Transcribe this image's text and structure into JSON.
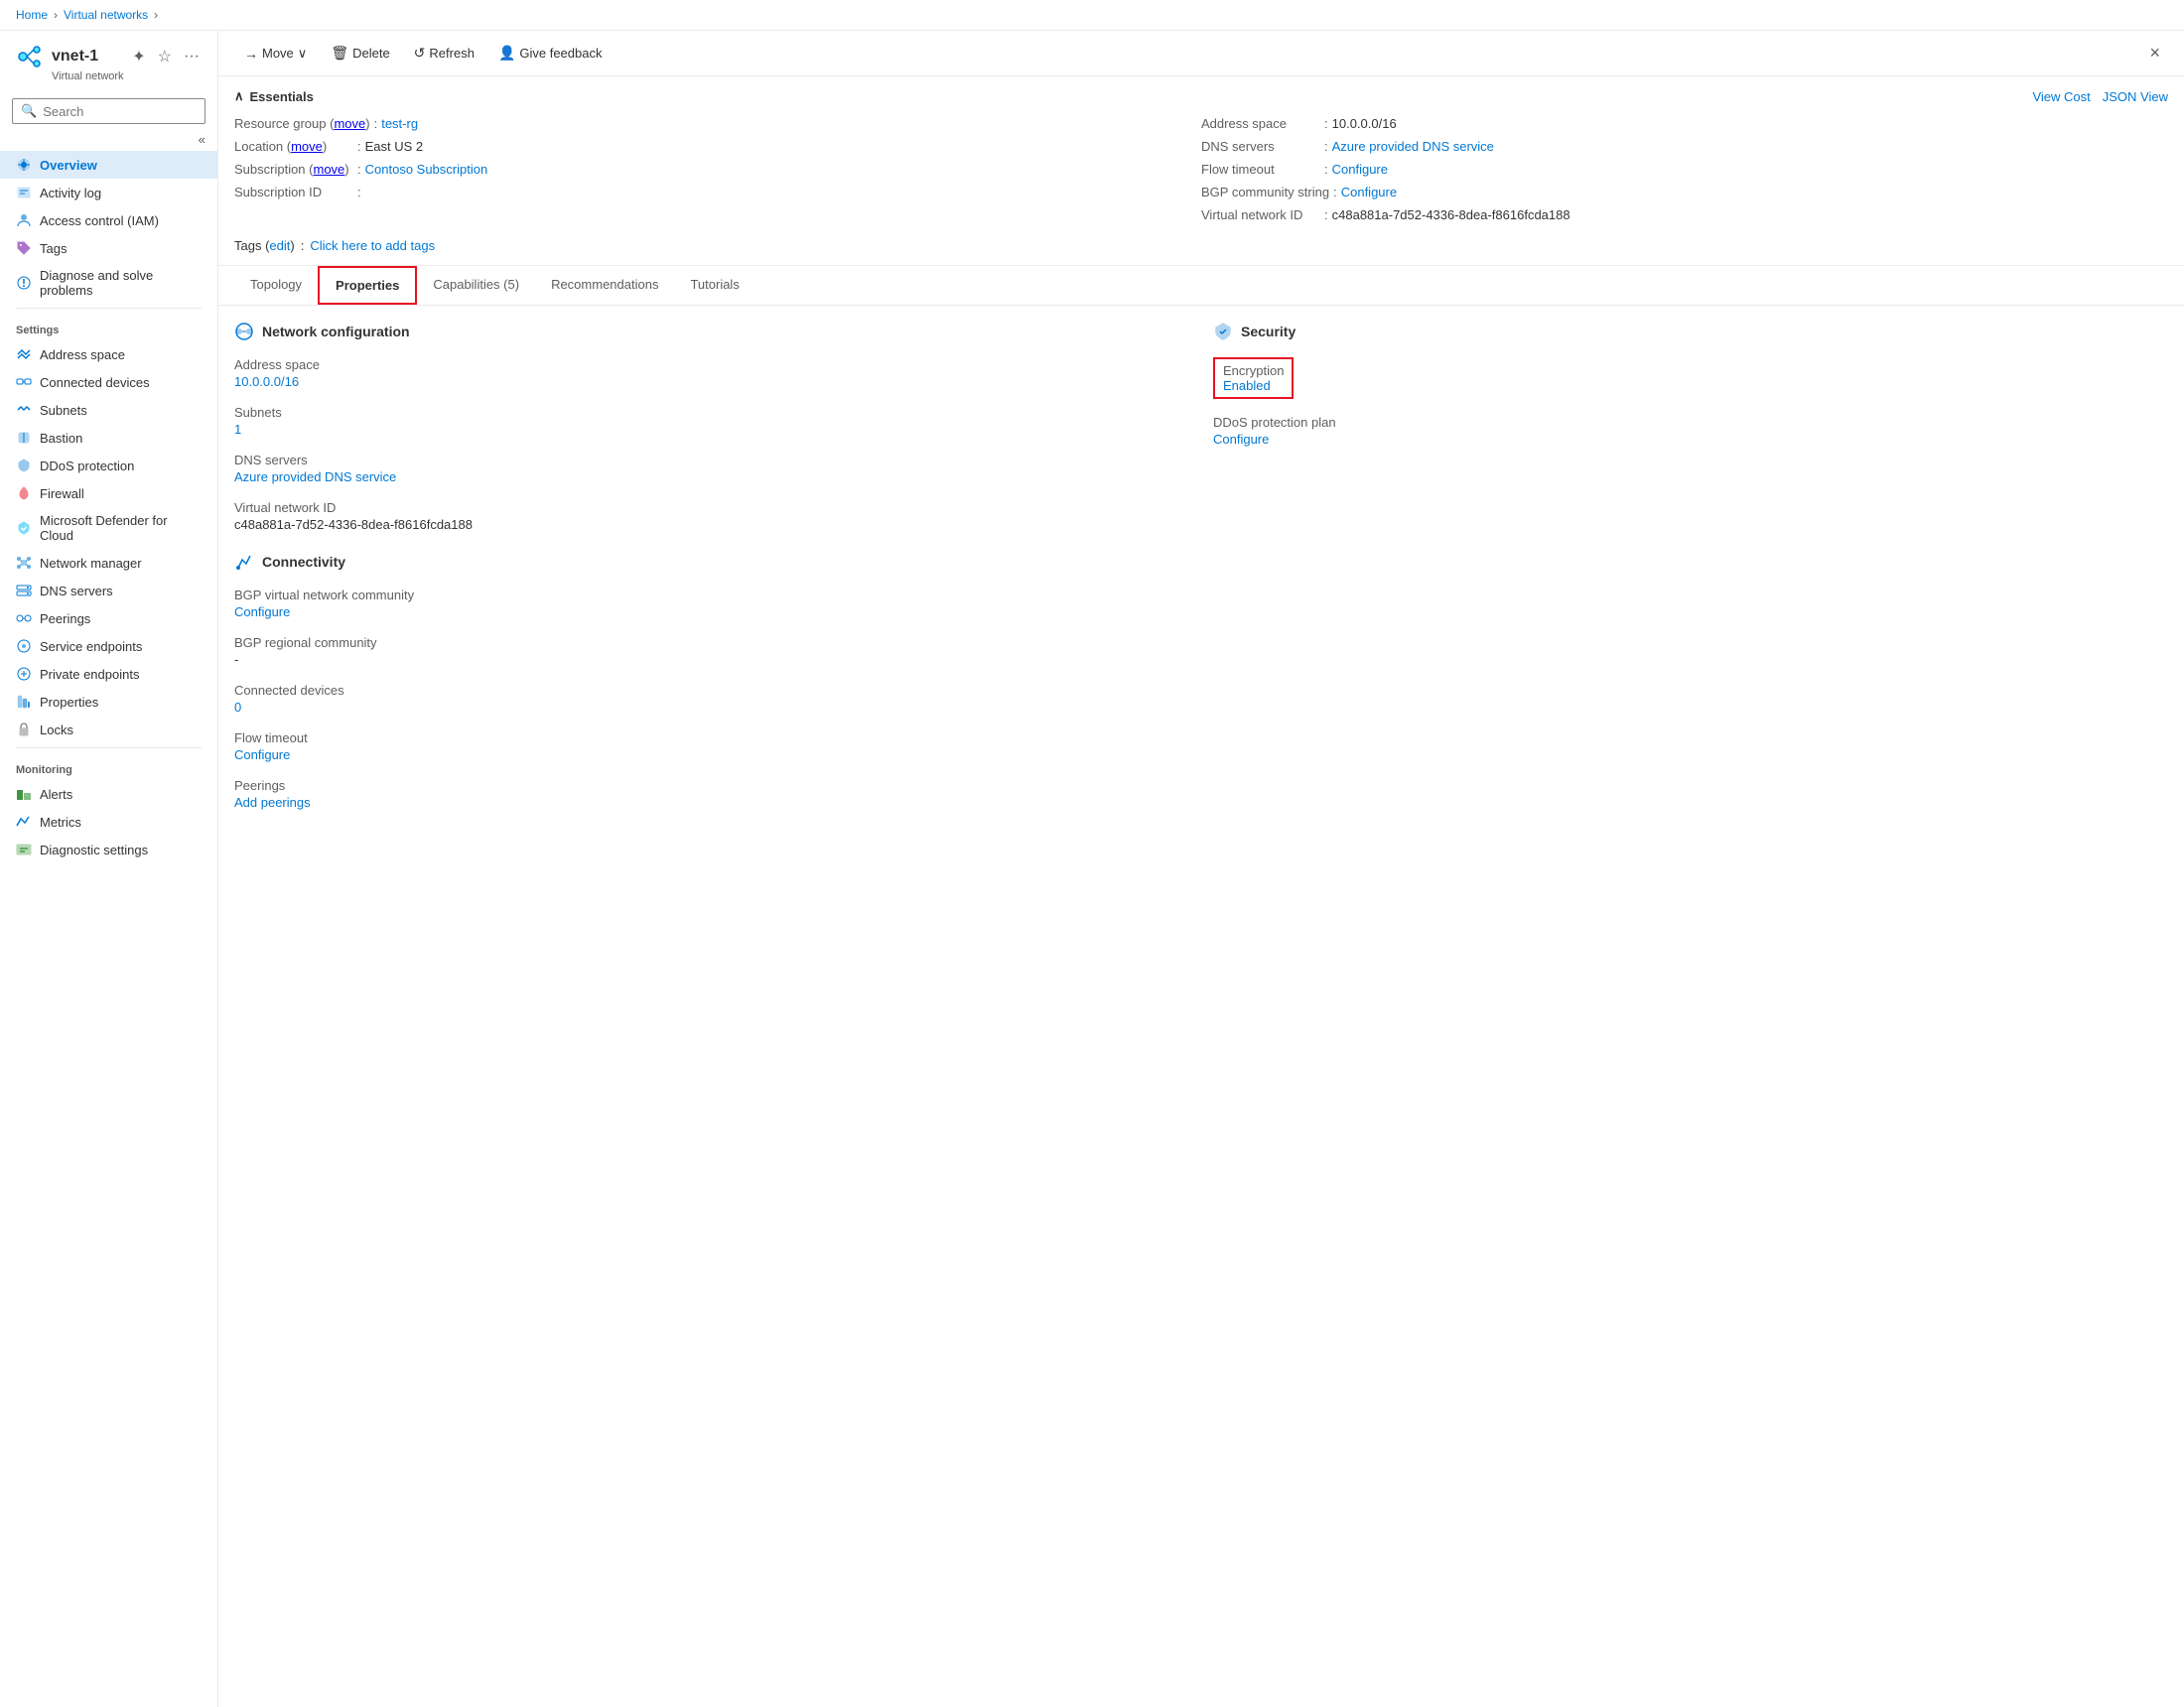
{
  "breadcrumb": {
    "home": "Home",
    "virtual_networks": "Virtual networks"
  },
  "sidebar": {
    "app_name": "vnet-1",
    "app_subtitle": "Virtual network",
    "search_placeholder": "Search",
    "collapse_icon": "«",
    "nav_items": [
      {
        "id": "overview",
        "label": "Overview",
        "icon": "vnet",
        "active": true
      },
      {
        "id": "activity-log",
        "label": "Activity log",
        "icon": "activity"
      },
      {
        "id": "access-control",
        "label": "Access control (IAM)",
        "icon": "iam"
      },
      {
        "id": "tags",
        "label": "Tags",
        "icon": "tags"
      },
      {
        "id": "diagnose",
        "label": "Diagnose and solve problems",
        "icon": "diagnose"
      }
    ],
    "settings_label": "Settings",
    "settings_items": [
      {
        "id": "address-space",
        "label": "Address space",
        "icon": "address"
      },
      {
        "id": "connected-devices",
        "label": "Connected devices",
        "icon": "connected"
      },
      {
        "id": "subnets",
        "label": "Subnets",
        "icon": "subnets"
      },
      {
        "id": "bastion",
        "label": "Bastion",
        "icon": "bastion"
      },
      {
        "id": "ddos-protection",
        "label": "DDoS protection",
        "icon": "ddos"
      },
      {
        "id": "firewall",
        "label": "Firewall",
        "icon": "firewall"
      },
      {
        "id": "microsoft-defender",
        "label": "Microsoft Defender for Cloud",
        "icon": "defender"
      },
      {
        "id": "network-manager",
        "label": "Network manager",
        "icon": "network-manager"
      },
      {
        "id": "dns-servers",
        "label": "DNS servers",
        "icon": "dns"
      },
      {
        "id": "peerings",
        "label": "Peerings",
        "icon": "peerings"
      },
      {
        "id": "service-endpoints",
        "label": "Service endpoints",
        "icon": "service-endpoints"
      },
      {
        "id": "private-endpoints",
        "label": "Private endpoints",
        "icon": "private-endpoints"
      },
      {
        "id": "properties",
        "label": "Properties",
        "icon": "properties"
      },
      {
        "id": "locks",
        "label": "Locks",
        "icon": "locks"
      }
    ],
    "monitoring_label": "Monitoring",
    "monitoring_items": [
      {
        "id": "alerts",
        "label": "Alerts",
        "icon": "alerts"
      },
      {
        "id": "metrics",
        "label": "Metrics",
        "icon": "metrics"
      },
      {
        "id": "diagnostic-settings",
        "label": "Diagnostic settings",
        "icon": "diagnostic"
      }
    ]
  },
  "toolbar": {
    "move_label": "Move",
    "delete_label": "Delete",
    "refresh_label": "Refresh",
    "feedback_label": "Give feedback",
    "close_icon": "×"
  },
  "essentials": {
    "title": "Essentials",
    "collapse_icon": "∧",
    "view_cost_label": "View Cost",
    "json_view_label": "JSON View",
    "resource_group_label": "Resource group (move)",
    "resource_group_value": "test-rg",
    "location_label": "Location (move)",
    "location_value": "East US 2",
    "subscription_label": "Subscription (move)",
    "subscription_value": "Contoso Subscription",
    "subscription_id_label": "Subscription ID",
    "subscription_id_value": "",
    "address_space_label": "Address space",
    "address_space_value": "10.0.0.0/16",
    "dns_servers_label": "DNS servers",
    "dns_servers_value": "Azure provided DNS service",
    "flow_timeout_label": "Flow timeout",
    "flow_timeout_value": "Configure",
    "bgp_community_label": "BGP community string",
    "bgp_community_value": "Configure",
    "virtual_network_id_label": "Virtual network ID",
    "virtual_network_id_value": "c48a881a-7d52-4336-8dea-f8616fcda188",
    "tags_label": "Tags (edit)",
    "tags_placeholder": "Click here to add tags"
  },
  "tabs": [
    {
      "id": "topology",
      "label": "Topology",
      "active": false,
      "highlighted": false
    },
    {
      "id": "properties",
      "label": "Properties",
      "active": true,
      "highlighted": true
    },
    {
      "id": "capabilities",
      "label": "Capabilities (5)",
      "active": false,
      "highlighted": false
    },
    {
      "id": "recommendations",
      "label": "Recommendations",
      "active": false,
      "highlighted": false
    },
    {
      "id": "tutorials",
      "label": "Tutorials",
      "active": false,
      "highlighted": false
    }
  ],
  "properties": {
    "network_config_title": "Network configuration",
    "address_space_label": "Address space",
    "address_space_value": "10.0.0.0/16",
    "subnets_label": "Subnets",
    "subnets_value": "1",
    "dns_servers_label": "DNS servers",
    "dns_servers_value": "Azure provided DNS service",
    "virtual_network_id_label": "Virtual network ID",
    "virtual_network_id_value": "c48a881a-7d52-4336-8dea-f8616fcda188",
    "connectivity_title": "Connectivity",
    "bgp_virtual_label": "BGP virtual network community",
    "bgp_virtual_value": "Configure",
    "bgp_regional_label": "BGP regional community",
    "bgp_regional_value": "-",
    "connected_devices_label": "Connected devices",
    "connected_devices_value": "0",
    "flow_timeout_label": "Flow timeout",
    "flow_timeout_value": "Configure",
    "peerings_label": "Peerings",
    "peerings_value": "Add peerings",
    "security_title": "Security",
    "encryption_label": "Encryption",
    "encryption_value": "Enabled",
    "ddos_plan_label": "DDoS protection plan",
    "ddos_plan_value": "Configure"
  }
}
